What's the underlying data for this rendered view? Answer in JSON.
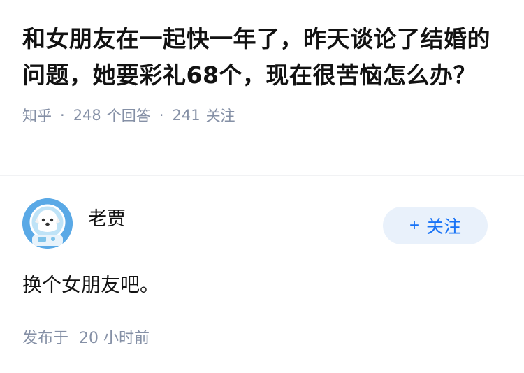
{
  "question": {
    "title": "和女朋友在一起快一年了，昨天谈论了结婚的问题，她要彩礼68个，现在很苦恼怎么办？",
    "source": "知乎",
    "separator": "·",
    "answers_count": "248",
    "answers_label": "个回答",
    "followers_count": "241",
    "followers_label": "关注"
  },
  "answer": {
    "author": "老贾",
    "avatar_icon": "astronaut-dog-avatar",
    "follow_label": "关注",
    "follow_prefix": "+",
    "content": "换个女朋友吧。",
    "published_label": "发布于",
    "published_time": "20 小时前"
  },
  "colors": {
    "accent": "#1772f6",
    "follow_bg": "#e9f1fb",
    "meta_text": "#8590a6",
    "avatar_bg": "#5aa9e6"
  }
}
